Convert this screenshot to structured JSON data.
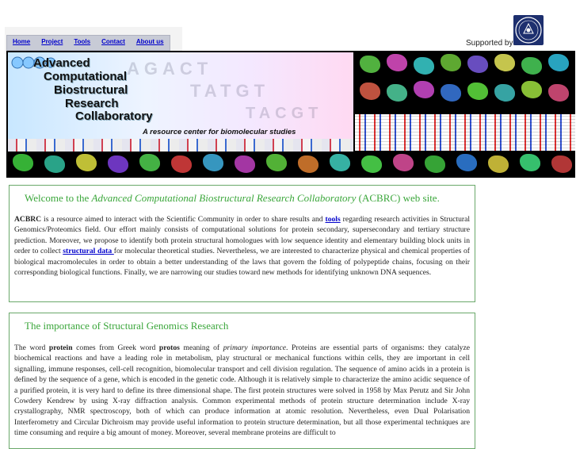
{
  "nav": {
    "items": [
      "Home",
      "Project",
      "Tools",
      "Contact",
      "About us"
    ]
  },
  "header": {
    "supported_by": "Supported by:"
  },
  "banner": {
    "title_lines": [
      "Advanced",
      "Computational",
      "Biostructural",
      "Research",
      "Collaboratory"
    ],
    "subtitle": "A resource center for biomolecular studies"
  },
  "welcome": {
    "heading_prefix": "Welcome to the ",
    "heading_italic": "Advanced Computational Biostructural Research Collaboratory",
    "heading_suffix": " (ACBRC) web site.",
    "acronym": "ACBRC",
    "text1": " is a resource aimed to interact with the Scientific Community in order to share results and ",
    "link_tools": "tools",
    "text2": " regarding research activities in Structural Genomics/Proteomics field. Our effort mainly consists of computational solutions for protein secondary, supersecondary and tertiary structure prediction. Moreover, we propose to identify both protein structural homologues with low sequence identity and elementary building block units in order to collect ",
    "link_structural_data": "structural data ",
    "text3": "for molecular theoretical studies. Nevertheless, we are interested to characterize physical and chemical properties of biological macromolecules in order to obtain a better understanding of the laws that govern the folding of polypeptide chains, focusing on their corresponding biological functions. Finally, we are narrowing our studies toward new methods for identifying unknown DNA sequences."
  },
  "importance": {
    "heading": "The importance of Structural Genomics Research",
    "t1": "The word ",
    "b1": "protein",
    "t2": " comes from Greek word ",
    "b2": "protos",
    "t3": " meaning of ",
    "i1": "primary importance",
    "t4": ". Proteins are essential parts of organisms: they catalyze biochemical reactions and have a leading role in metabolism, play structural or mechanical functions within cells, they are important in cell signalling, immune responses, cell-cell recognition, biomolecular transport and cell division regulation. The sequence of amino acids in a protein is defined by the sequence of a gene, which is encoded in the genetic code. Although it is relatively simple to characterize the amino acidic sequence of a purified protein, it is very hard to define its three dimensional shape. The first protein structures were solved in 1958 by Max Perutz and Sir John Cowdery Kendrew by using X-ray diffraction analysis. Common experimental methods of protein structure determination include X-ray crystallography, NMR spectroscopy, both of which can produce information at atomic resolution. Nevertheless, even Dual Polarisation Interferometry and Circular Dichroism may provide useful information to protein structure determination, but all those experimental techniques are time consuming and require a big amount of money. Moreover, several membrane proteins are difficult to"
  }
}
